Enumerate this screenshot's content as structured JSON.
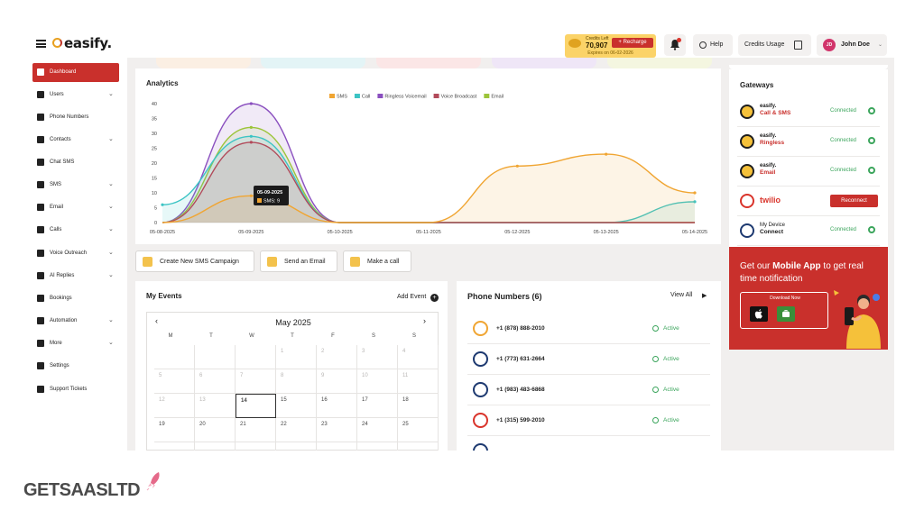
{
  "header": {
    "logo": "easify.",
    "credits_label": "Credits Left",
    "credits_value": "70,907",
    "recharge_label": "+ Recharge",
    "expires": "Expires on 06-02-2026",
    "help_label": "Help",
    "credits_usage_label": "Credits Usage",
    "user_initials": "JD",
    "user_name": "John Doe"
  },
  "sidebar": {
    "items": [
      {
        "label": "Dashboard",
        "active": true,
        "chevron": false
      },
      {
        "label": "Users",
        "chevron": true
      },
      {
        "label": "Phone Numbers",
        "chevron": false
      },
      {
        "label": "Contacts",
        "chevron": true
      },
      {
        "label": "Chat SMS",
        "chevron": false
      },
      {
        "label": "SMS",
        "chevron": true
      },
      {
        "label": "Email",
        "chevron": true
      },
      {
        "label": "Calls",
        "chevron": true
      },
      {
        "label": "Voice Outreach",
        "chevron": true
      },
      {
        "label": "AI Replies",
        "chevron": true
      },
      {
        "label": "Bookings",
        "chevron": false
      },
      {
        "label": "Automation",
        "chevron": true
      },
      {
        "label": "More",
        "chevron": true
      },
      {
        "label": "Settings",
        "chevron": false
      },
      {
        "label": "Support Tickets",
        "chevron": false
      }
    ]
  },
  "analytics": {
    "title": "Analytics",
    "tooltip_date": "05-09-2025",
    "tooltip_value": "SMS: 9"
  },
  "chart_data": {
    "type": "area",
    "x": [
      "05-08-2025",
      "05-09-2025",
      "05-10-2025",
      "05-11-2025",
      "05-12-2025",
      "05-13-2025",
      "05-14-2025"
    ],
    "ylim": [
      0,
      40
    ],
    "yticks": [
      0,
      5,
      10,
      15,
      20,
      25,
      30,
      35,
      40
    ],
    "legend_position": "top-center",
    "series": [
      {
        "name": "SMS",
        "color": "#f0a532",
        "values": [
          0,
          9,
          0,
          0,
          19,
          23,
          10
        ]
      },
      {
        "name": "Call",
        "color": "#3cc4c4",
        "values": [
          6,
          29,
          0,
          0,
          0,
          0,
          7
        ]
      },
      {
        "name": "Ringless Voicemail",
        "color": "#8a4fbf",
        "values": [
          0,
          40,
          0,
          0,
          0,
          0,
          0
        ]
      },
      {
        "name": "Voice Broadcast",
        "color": "#b24a5a",
        "values": [
          0,
          27,
          0,
          0,
          0,
          0,
          0
        ]
      },
      {
        "name": "Email",
        "color": "#9cc43a",
        "values": [
          0,
          32,
          0,
          0,
          0,
          0,
          0
        ]
      }
    ]
  },
  "actions": [
    {
      "label": "Create New SMS Campaign"
    },
    {
      "label": "Send an Email"
    },
    {
      "label": "Make a call"
    }
  ],
  "events": {
    "title": "My Events",
    "add_label": "Add Event",
    "month": "May 2025",
    "days_of_week": [
      "M",
      "T",
      "W",
      "T",
      "F",
      "S",
      "S"
    ],
    "weeks": [
      [
        "",
        "",
        "",
        "1",
        "2",
        "3",
        "4"
      ],
      [
        "5",
        "6",
        "7",
        "8",
        "9",
        "10",
        "11"
      ],
      [
        "12",
        "13",
        "14",
        "15",
        "16",
        "17",
        "18"
      ],
      [
        "19",
        "20",
        "21",
        "22",
        "23",
        "24",
        "25"
      ]
    ],
    "today": "14"
  },
  "phones": {
    "title": "Phone Numbers (6)",
    "view_all": "View All",
    "rows": [
      {
        "number": "+1 (878) 888-2010",
        "status": "Active"
      },
      {
        "number": "+1 (773) 631-2664",
        "status": "Active"
      },
      {
        "number": "+1 (983) 483-6868",
        "status": "Active"
      },
      {
        "number": "+1 (315) 599-2010",
        "status": "Active"
      }
    ]
  },
  "gateways": {
    "title": "Gateways",
    "rows": [
      {
        "brand": "easify.",
        "name": "Call & SMS",
        "status": "Connected"
      },
      {
        "brand": "easify.",
        "name": "Ringless",
        "status": "Connected"
      },
      {
        "brand": "easify.",
        "name": "Email",
        "status": "Connected"
      },
      {
        "brand": "twilio",
        "name": "",
        "status": "Reconnect"
      },
      {
        "brand": "My Device",
        "name": "Connect",
        "status": "Connected"
      }
    ]
  },
  "promo": {
    "line1_prefix": "Get our ",
    "line1_bold": "Mobile App",
    "line1_suffix": " to get real",
    "line2": "time notification",
    "download_label": "Download Now"
  },
  "watermark": "GETSAASLTD"
}
